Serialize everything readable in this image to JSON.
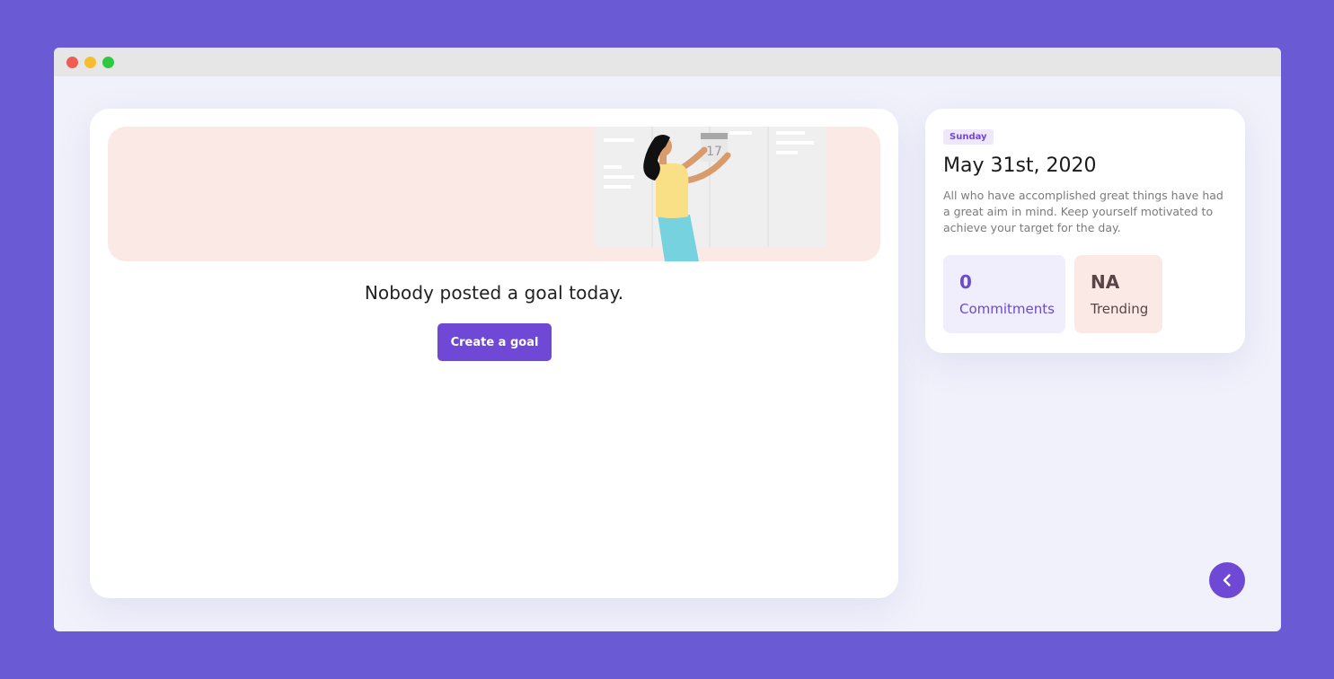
{
  "window": {
    "controls": [
      "close",
      "minimize",
      "maximize"
    ],
    "accent_color": "#7048d6",
    "background_color": "#6a5ad4"
  },
  "feed": {
    "illustration": "woman-pinning-calendar-illustration",
    "calendar_day": "17",
    "empty_message": "Nobody posted a goal today.",
    "create_button_label": "Create a goal"
  },
  "summary": {
    "day": "Sunday",
    "date": "May 31st, 2020",
    "quote": "All who have accomplished great things have had a great aim in mind. Keep yourself motivated to achieve your target for the day.",
    "stats": [
      {
        "value": "0",
        "label": "Commitments",
        "color": "#6b4bcc",
        "bg": "#f0edfd"
      },
      {
        "value": "NA",
        "label": "Trending",
        "color": "#5a4448",
        "bg": "#fbe9e6"
      }
    ]
  },
  "nav": {
    "back_icon": "chevron-left-icon"
  }
}
